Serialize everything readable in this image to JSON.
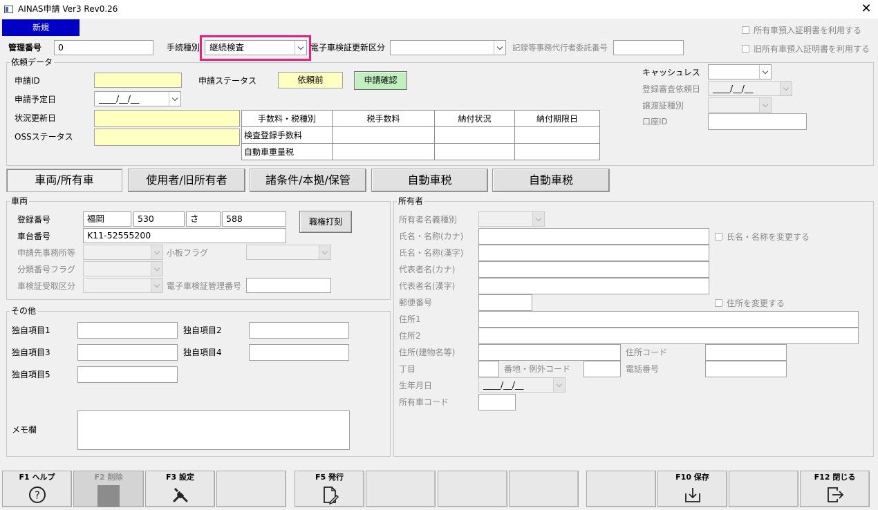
{
  "window": {
    "title": "AINAS申請 Ver3 Rev0.26"
  },
  "header": {
    "new_button": "新規",
    "kanri_label": "管理番号",
    "kanri_value": "0",
    "tetsuzuki_label": "手続種別",
    "tetsuzuki_value": "継続検査",
    "denshi_label": "電子車検証更新区分",
    "denshi_value": "",
    "kiroku_label": "記録等事務代行者委託番号",
    "kiroku_value": "",
    "chk_shoyu": "所有車預入証明書を利用する",
    "chk_kyu": "旧所有車預入証明書を利用する"
  },
  "irai": {
    "legend": "依頼データ",
    "shinsei_id_label": "申請ID",
    "shinsei_id_value": "",
    "status_label": "申請ステータス",
    "status_value": "依頼前",
    "kakunin_button": "申請確認",
    "yotei_label": "申請予定日",
    "yotei_value": "____/__/__",
    "jokyo_label": "状況更新日",
    "jokyo_value": "",
    "oss_label": "OSSステータス",
    "oss_value": "",
    "fee_headers": [
      "手数料・税種別",
      "税手数料",
      "納付状況",
      "納付期限日"
    ],
    "fee_rows": [
      [
        "検査登録手数料",
        "",
        "",
        ""
      ],
      [
        "自動車重量税",
        "",
        "",
        ""
      ]
    ],
    "cashless_label": "キャッシュレス",
    "cashless_value": "",
    "toroku_label": "登録審査依頼日",
    "toroku_value": "____/__/__",
    "joto_label": "譲渡証種別",
    "joto_value": "",
    "koza_label": "口座ID",
    "koza_value": ""
  },
  "tabs": [
    "車両/所有車",
    "使用者/旧所有者",
    "諸条件/本拠/保管",
    "自動車税",
    "自動車税"
  ],
  "sharyo": {
    "legend": "車両",
    "toroku_label": "登録番号",
    "toroku_values": [
      "福岡",
      "530",
      "さ",
      "588"
    ],
    "shokken_button": "職権打刻",
    "shadai_label": "車台番号",
    "shadai_value": "K11-52555200",
    "jimusho_label": "申請先事務所等",
    "koita_label": "小板フラグ",
    "bunrui_label": "分類番号フラグ",
    "juryo_label": "車検証受取区分",
    "denshi_kanri_label": "電子車検証管理番号"
  },
  "sonota": {
    "legend": "その他",
    "items": [
      "独自項目1",
      "独自項目2",
      "独自項目3",
      "独自項目4",
      "独自項目5"
    ],
    "memo_label": "メモ欄"
  },
  "shoyusha": {
    "legend": "所有者",
    "shubetsu_label": "所有者名義種別",
    "kana_label": "氏名・名称(カナ)",
    "kanji_label": "氏名・名称(漢字)",
    "dai_kana_label": "代表者名(カナ)",
    "dai_kanji_label": "代表者名(漢字)",
    "yubin_label": "郵便番号",
    "jusho1_label": "住所1",
    "jusho2_label": "住所2",
    "tatemono_label": "住所(建物名等)",
    "jusho_code_label": "住所コード",
    "chome_label": "丁目",
    "banchi_label": "番地・例外コード",
    "denwa_label": "電話番号",
    "seinen_label": "生年月日",
    "seinen_value": "____/__/__",
    "shoyusha_code_label": "所有車コード",
    "chk_name": "氏名・名称を変更する",
    "chk_jusho": "住所を変更する"
  },
  "fkeys": {
    "f1": "F1 ヘルプ",
    "f2": "F2 削除",
    "f3": "F3 設定",
    "f5": "F5 発行",
    "f10": "F10 保存",
    "f12": "F12 閉じる"
  }
}
